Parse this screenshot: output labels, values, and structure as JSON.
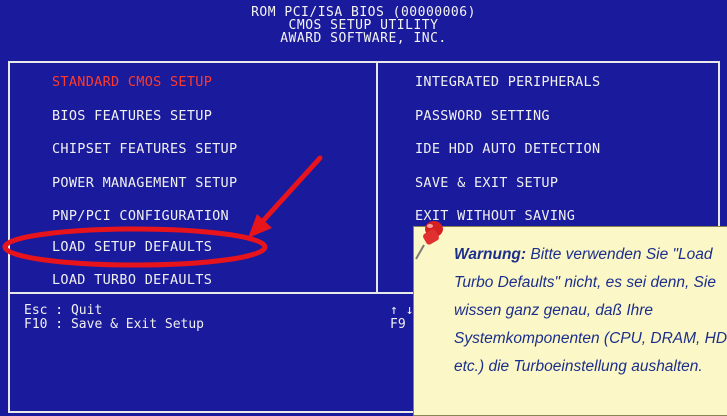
{
  "header": {
    "line1": "ROM PCI/ISA BIOS (00000006)",
    "line2": "CMOS SETUP UTILITY",
    "line3": "AWARD SOFTWARE, INC."
  },
  "menu_left": [
    "STANDARD CMOS SETUP",
    "BIOS FEATURES SETUP",
    "CHIPSET FEATURES SETUP",
    "POWER MANAGEMENT SETUP",
    "PNP/PCI CONFIGURATION",
    "LOAD SETUP DEFAULTS",
    "LOAD TURBO DEFAULTS"
  ],
  "menu_right": [
    "INTEGRATED PERIPHERALS",
    "PASSWORD SETTING",
    "IDE HDD AUTO DETECTION",
    "SAVE & EXIT SETUP",
    "EXIT WITHOUT SAVING"
  ],
  "help_left": {
    "esc": "Esc : Quit",
    "f10": "F10 : Save & Exit Setup"
  },
  "help_right": {
    "arrows": "↑ ↓",
    "f9": "F9"
  },
  "note": {
    "title": "Warnung:",
    "body": "Bitte verwenden Sie \"Load Turbo Defaults\" nicht, es sei denn, Sie wissen ganz genau, daß Ihre Systemkomponenten (CPU, DRAM, HDD etc.) die Turboeinstellung aushalten."
  },
  "colors": {
    "background": "#1a1a9c",
    "selected": "#ff3a2a",
    "annotation_red": "#e8141c",
    "note_bg": "#fbf7c6",
    "note_text": "#1c2f8c"
  }
}
